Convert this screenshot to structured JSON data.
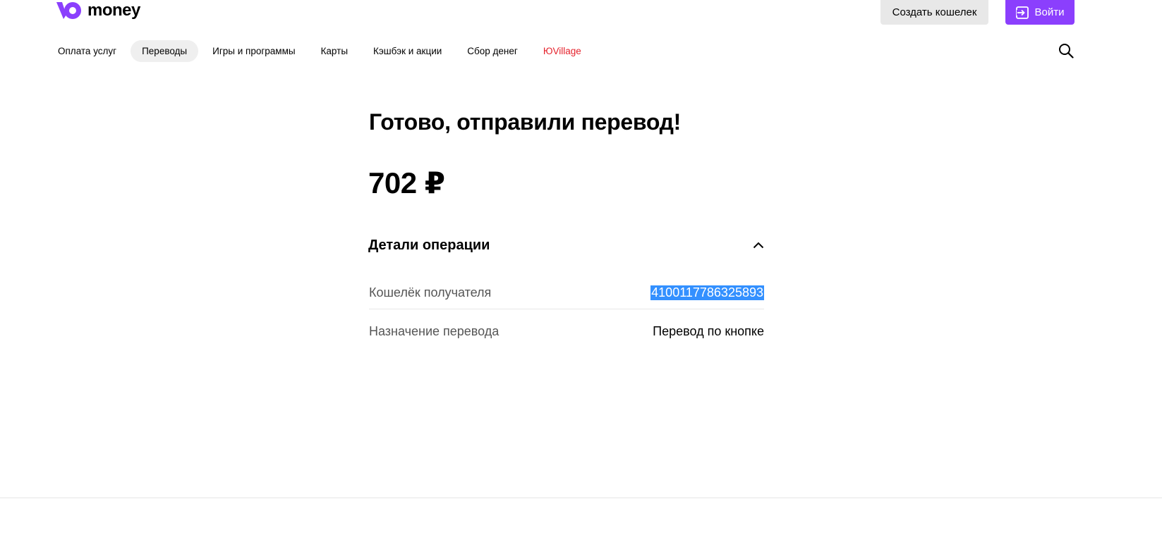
{
  "header": {
    "logo_text": "money",
    "create_wallet_label": "Создать кошелек",
    "login_label": "Войти"
  },
  "nav": {
    "items": [
      {
        "label": "Оплата услуг"
      },
      {
        "label": "Переводы"
      },
      {
        "label": "Игры и программы"
      },
      {
        "label": "Карты"
      },
      {
        "label": "Кэшбэк и акции"
      },
      {
        "label": "Сбор денег"
      },
      {
        "label": "ЮVillage"
      }
    ],
    "active_index": 1
  },
  "main": {
    "title": "Готово, отправили перевод!",
    "amount": "702 ₽",
    "details": {
      "title": "Детали операции",
      "rows": [
        {
          "label": "Кошелёк получателя",
          "value": "4100117786325893"
        },
        {
          "label": "Назначение перевода",
          "value": "Перевод по кнопке"
        }
      ]
    }
  },
  "colors": {
    "brand": "#8b3ffd",
    "accent_link": "#e5212b",
    "selection": "#3390ff"
  },
  "icons": [
    "logo-icon",
    "login-icon",
    "search-icon",
    "chevron-up-icon"
  ]
}
